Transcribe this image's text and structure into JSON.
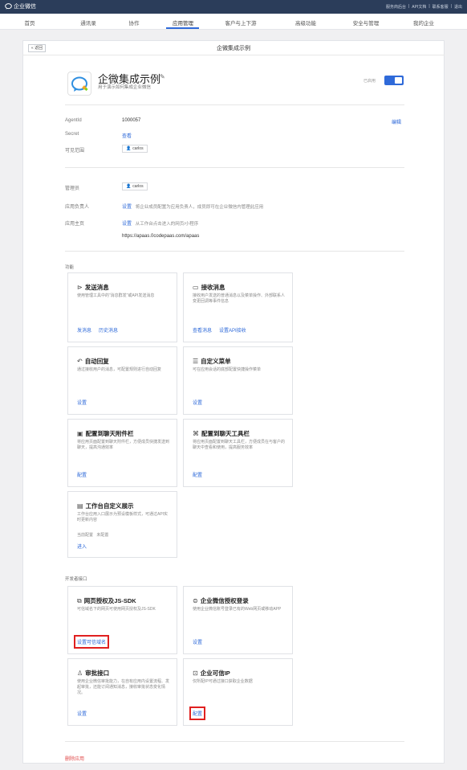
{
  "topbar": {
    "brand": "企业微信",
    "links": [
      "服务商后台",
      "API文档",
      "联系客服",
      "退出"
    ],
    "separator": "|"
  },
  "nav": {
    "items": [
      "首页",
      "通讯录",
      "协作",
      "应用管理",
      "客户与上下游",
      "高级功能",
      "安全与管理",
      "我的企业"
    ],
    "active_index": 3
  },
  "page": {
    "back_label": "« 返回",
    "title": "企微集成示例"
  },
  "app": {
    "name": "企微集成示例",
    "description": "用于演示如何集成企业微信",
    "status": "已启用",
    "enabled": true
  },
  "credentials": {
    "agentid_label": "AgentId",
    "agentid_value": "1000057",
    "secret_label": "Secret",
    "secret_link": "查看",
    "visible_label": "可见范围",
    "visible_user": "carlos",
    "edit_link": "编辑"
  },
  "management": {
    "admin_label": "管理员",
    "admin_user": "carlos",
    "owner_label": "应用负责人",
    "owner_link": "设置",
    "owner_note": "将企业成员配置为应用负责人，成员即可在企业微信内管理此应用",
    "home_label": "应用主页",
    "home_link": "设置",
    "home_note": "从工作台点击进入的网页/小程序",
    "home_url": "https://apaas.0codepaas.com/apaas"
  },
  "features": {
    "section_label": "功能",
    "cards": [
      {
        "title": "发送消息",
        "icon": "send-icon",
        "desc": "使用管理工具中的“消息群发”或API发送消息",
        "links": [
          "发消息",
          "历史消息"
        ]
      },
      {
        "title": "接收消息",
        "icon": "message-icon",
        "desc": "接收用户发送的普通消息以及菜单操作、外部联系人变更回调等事件信息",
        "links": [
          "查看消息",
          "设置API接收"
        ]
      },
      {
        "title": "自动回复",
        "icon": "reply-icon",
        "desc": "通过接收用户的消息，可配置规则进行自动回复",
        "links": [
          "设置"
        ]
      },
      {
        "title": "自定义菜单",
        "icon": "menu-icon",
        "desc": "可在应用会话的底部配置快捷操作菜单",
        "links": [
          "设置"
        ]
      },
      {
        "title": "配置到聊天附件栏",
        "icon": "attachment-icon",
        "desc": "将应用页面配置到聊天附件栏，方便成员快捷发送到聊天，提高沟通效率",
        "links": [
          "配置"
        ]
      },
      {
        "title": "配置到聊天工具栏",
        "icon": "toolbar-icon",
        "desc": "将应用页面配置到聊天工具栏，方便成员在与客户的聊天中查看和使用，提高服务效率",
        "links": [
          "配置"
        ]
      },
      {
        "title": "工作台自定义展示",
        "icon": "workbench-icon",
        "desc": "工作台应用入口展示为预设模板样式，可通过API实时更新内容",
        "current_label": "当前配置",
        "current_value": "未配置",
        "links": [
          "进入"
        ]
      }
    ]
  },
  "developer": {
    "section_label": "开发者接口",
    "cards": [
      {
        "title": "网页授权及JS-SDK",
        "icon": "web-auth-icon",
        "desc": "可信域名下的网页可使用网页授权及JS-SDK",
        "links": [
          "设置可信域名"
        ]
      },
      {
        "title": "企业微信授权登录",
        "icon": "login-icon",
        "desc": "使用企业微信账号登录已有的Web网页或移动APP",
        "links": [
          "设置"
        ]
      },
      {
        "title": "审批接口",
        "icon": "approval-icon",
        "desc": "使用企业微信审批能力，在自有应用内设置流程、发起审批，还能订阅通知消息，接收审批状态变化情况。",
        "links": [
          "设置"
        ]
      },
      {
        "title": "企业可信IP",
        "icon": "ip-icon",
        "desc": "仅所配IP可通过接口获取企业数据",
        "links": [
          "配置"
        ]
      }
    ]
  },
  "footer": {
    "delete_label": "删除应用"
  }
}
